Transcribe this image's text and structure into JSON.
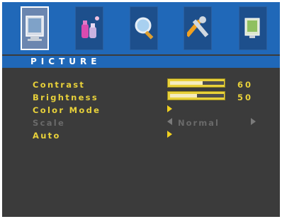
{
  "header": {
    "title": "PICTURE"
  },
  "tabs": [
    {
      "icon": "monitor-picture-icon",
      "active": true
    },
    {
      "icon": "color-bottles-icon",
      "active": false
    },
    {
      "icon": "magnifier-icon",
      "active": false
    },
    {
      "icon": "tools-wrench-icon",
      "active": false
    },
    {
      "icon": "display-settings-icon",
      "active": false
    }
  ],
  "menu": {
    "contrast": {
      "label": "Contrast",
      "value": "60",
      "level": 0.6
    },
    "brightness": {
      "label": "Brightness",
      "value": "50",
      "level": 0.5
    },
    "color_mode": {
      "label": "Color Mode"
    },
    "scale": {
      "label": "Scale",
      "value": "Normal",
      "enabled": false
    },
    "auto": {
      "label": "Auto"
    }
  },
  "colors": {
    "menu_text": "#e8d13a",
    "disabled_text": "#6a6a6a",
    "bar_blue": "#2068b8",
    "background": "#3b3b3b"
  }
}
